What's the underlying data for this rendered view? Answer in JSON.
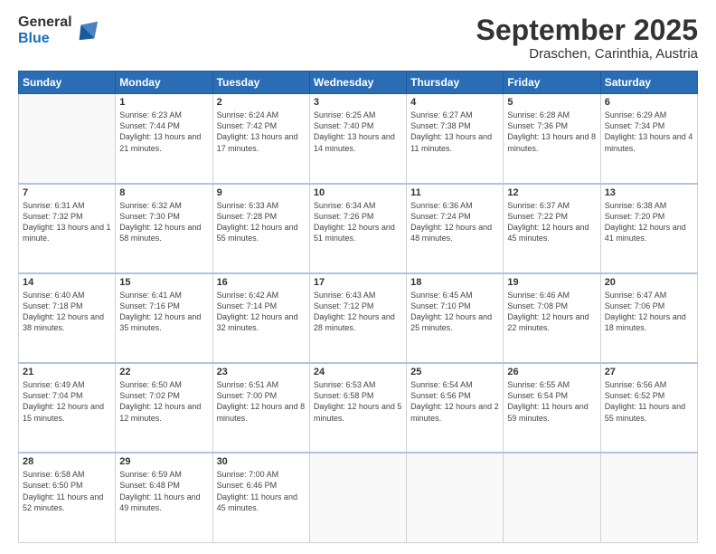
{
  "logo": {
    "general": "General",
    "blue": "Blue"
  },
  "header": {
    "month": "September 2025",
    "location": "Draschen, Carinthia, Austria"
  },
  "weekdays": [
    "Sunday",
    "Monday",
    "Tuesday",
    "Wednesday",
    "Thursday",
    "Friday",
    "Saturday"
  ],
  "weeks": [
    [
      {
        "day": "",
        "empty": true
      },
      {
        "day": "1",
        "sunrise": "Sunrise: 6:23 AM",
        "sunset": "Sunset: 7:44 PM",
        "daylight": "Daylight: 13 hours and 21 minutes."
      },
      {
        "day": "2",
        "sunrise": "Sunrise: 6:24 AM",
        "sunset": "Sunset: 7:42 PM",
        "daylight": "Daylight: 13 hours and 17 minutes."
      },
      {
        "day": "3",
        "sunrise": "Sunrise: 6:25 AM",
        "sunset": "Sunset: 7:40 PM",
        "daylight": "Daylight: 13 hours and 14 minutes."
      },
      {
        "day": "4",
        "sunrise": "Sunrise: 6:27 AM",
        "sunset": "Sunset: 7:38 PM",
        "daylight": "Daylight: 13 hours and 11 minutes."
      },
      {
        "day": "5",
        "sunrise": "Sunrise: 6:28 AM",
        "sunset": "Sunset: 7:36 PM",
        "daylight": "Daylight: 13 hours and 8 minutes."
      },
      {
        "day": "6",
        "sunrise": "Sunrise: 6:29 AM",
        "sunset": "Sunset: 7:34 PM",
        "daylight": "Daylight: 13 hours and 4 minutes."
      }
    ],
    [
      {
        "day": "7",
        "sunrise": "Sunrise: 6:31 AM",
        "sunset": "Sunset: 7:32 PM",
        "daylight": "Daylight: 13 hours and 1 minute."
      },
      {
        "day": "8",
        "sunrise": "Sunrise: 6:32 AM",
        "sunset": "Sunset: 7:30 PM",
        "daylight": "Daylight: 12 hours and 58 minutes."
      },
      {
        "day": "9",
        "sunrise": "Sunrise: 6:33 AM",
        "sunset": "Sunset: 7:28 PM",
        "daylight": "Daylight: 12 hours and 55 minutes."
      },
      {
        "day": "10",
        "sunrise": "Sunrise: 6:34 AM",
        "sunset": "Sunset: 7:26 PM",
        "daylight": "Daylight: 12 hours and 51 minutes."
      },
      {
        "day": "11",
        "sunrise": "Sunrise: 6:36 AM",
        "sunset": "Sunset: 7:24 PM",
        "daylight": "Daylight: 12 hours and 48 minutes."
      },
      {
        "day": "12",
        "sunrise": "Sunrise: 6:37 AM",
        "sunset": "Sunset: 7:22 PM",
        "daylight": "Daylight: 12 hours and 45 minutes."
      },
      {
        "day": "13",
        "sunrise": "Sunrise: 6:38 AM",
        "sunset": "Sunset: 7:20 PM",
        "daylight": "Daylight: 12 hours and 41 minutes."
      }
    ],
    [
      {
        "day": "14",
        "sunrise": "Sunrise: 6:40 AM",
        "sunset": "Sunset: 7:18 PM",
        "daylight": "Daylight: 12 hours and 38 minutes."
      },
      {
        "day": "15",
        "sunrise": "Sunrise: 6:41 AM",
        "sunset": "Sunset: 7:16 PM",
        "daylight": "Daylight: 12 hours and 35 minutes."
      },
      {
        "day": "16",
        "sunrise": "Sunrise: 6:42 AM",
        "sunset": "Sunset: 7:14 PM",
        "daylight": "Daylight: 12 hours and 32 minutes."
      },
      {
        "day": "17",
        "sunrise": "Sunrise: 6:43 AM",
        "sunset": "Sunset: 7:12 PM",
        "daylight": "Daylight: 12 hours and 28 minutes."
      },
      {
        "day": "18",
        "sunrise": "Sunrise: 6:45 AM",
        "sunset": "Sunset: 7:10 PM",
        "daylight": "Daylight: 12 hours and 25 minutes."
      },
      {
        "day": "19",
        "sunrise": "Sunrise: 6:46 AM",
        "sunset": "Sunset: 7:08 PM",
        "daylight": "Daylight: 12 hours and 22 minutes."
      },
      {
        "day": "20",
        "sunrise": "Sunrise: 6:47 AM",
        "sunset": "Sunset: 7:06 PM",
        "daylight": "Daylight: 12 hours and 18 minutes."
      }
    ],
    [
      {
        "day": "21",
        "sunrise": "Sunrise: 6:49 AM",
        "sunset": "Sunset: 7:04 PM",
        "daylight": "Daylight: 12 hours and 15 minutes."
      },
      {
        "day": "22",
        "sunrise": "Sunrise: 6:50 AM",
        "sunset": "Sunset: 7:02 PM",
        "daylight": "Daylight: 12 hours and 12 minutes."
      },
      {
        "day": "23",
        "sunrise": "Sunrise: 6:51 AM",
        "sunset": "Sunset: 7:00 PM",
        "daylight": "Daylight: 12 hours and 8 minutes."
      },
      {
        "day": "24",
        "sunrise": "Sunrise: 6:53 AM",
        "sunset": "Sunset: 6:58 PM",
        "daylight": "Daylight: 12 hours and 5 minutes."
      },
      {
        "day": "25",
        "sunrise": "Sunrise: 6:54 AM",
        "sunset": "Sunset: 6:56 PM",
        "daylight": "Daylight: 12 hours and 2 minutes."
      },
      {
        "day": "26",
        "sunrise": "Sunrise: 6:55 AM",
        "sunset": "Sunset: 6:54 PM",
        "daylight": "Daylight: 11 hours and 59 minutes."
      },
      {
        "day": "27",
        "sunrise": "Sunrise: 6:56 AM",
        "sunset": "Sunset: 6:52 PM",
        "daylight": "Daylight: 11 hours and 55 minutes."
      }
    ],
    [
      {
        "day": "28",
        "sunrise": "Sunrise: 6:58 AM",
        "sunset": "Sunset: 6:50 PM",
        "daylight": "Daylight: 11 hours and 52 minutes."
      },
      {
        "day": "29",
        "sunrise": "Sunrise: 6:59 AM",
        "sunset": "Sunset: 6:48 PM",
        "daylight": "Daylight: 11 hours and 49 minutes."
      },
      {
        "day": "30",
        "sunrise": "Sunrise: 7:00 AM",
        "sunset": "Sunset: 6:46 PM",
        "daylight": "Daylight: 11 hours and 45 minutes."
      },
      {
        "day": "",
        "empty": true
      },
      {
        "day": "",
        "empty": true
      },
      {
        "day": "",
        "empty": true
      },
      {
        "day": "",
        "empty": true
      }
    ]
  ]
}
